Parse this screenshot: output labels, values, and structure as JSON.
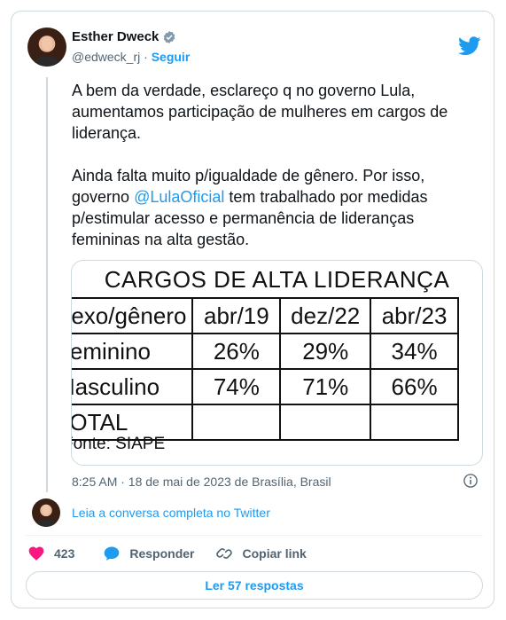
{
  "author": {
    "name": "Esther Dweck",
    "handle": "@edweck_rj",
    "separator": "·",
    "follow_label": "Seguir"
  },
  "tweet": {
    "text_part1": "A bem da verdade, esclareço q no governo Lula, aumentamos participação de mulheres em cargos de liderança.\n\nAinda falta muito p/igualdade de gênero. Por isso, governo ",
    "mention": "@LulaOficial",
    "text_part2": " tem trabalhado por medidas p/estimular acesso e permanência de lideranças femininas na alta gestão."
  },
  "image": {
    "title": "CARGOS DE ALTA LIDERANÇA",
    "header": [
      "Sexo/gênero",
      "abr/19",
      "dez/22",
      "abr/23"
    ],
    "rows": [
      [
        "Feminino",
        "26%",
        "29%",
        "34%"
      ],
      [
        "Masculino",
        "74%",
        "71%",
        "66%"
      ],
      [
        "TOTAL",
        "",
        "",
        ""
      ]
    ],
    "source": "Fonte: SIAPE"
  },
  "timestamp": "8:25 AM · 18 de mai de 2023 de Brasília, Brasil",
  "read_thread_label": "Leia a conversa completa no Twitter",
  "actions": {
    "like_count": "423",
    "reply_label": "Responder",
    "copy_label": "Copiar link"
  },
  "read_replies_label": "Ler 57 respostas",
  "colors": {
    "accent": "#1d9bf0",
    "like": "#f91880",
    "text": "#0f1419",
    "muted": "#536471"
  },
  "icons": [
    "verified-badge-icon",
    "twitter-bird-icon",
    "info-icon",
    "heart-icon",
    "reply-icon",
    "link-icon"
  ]
}
